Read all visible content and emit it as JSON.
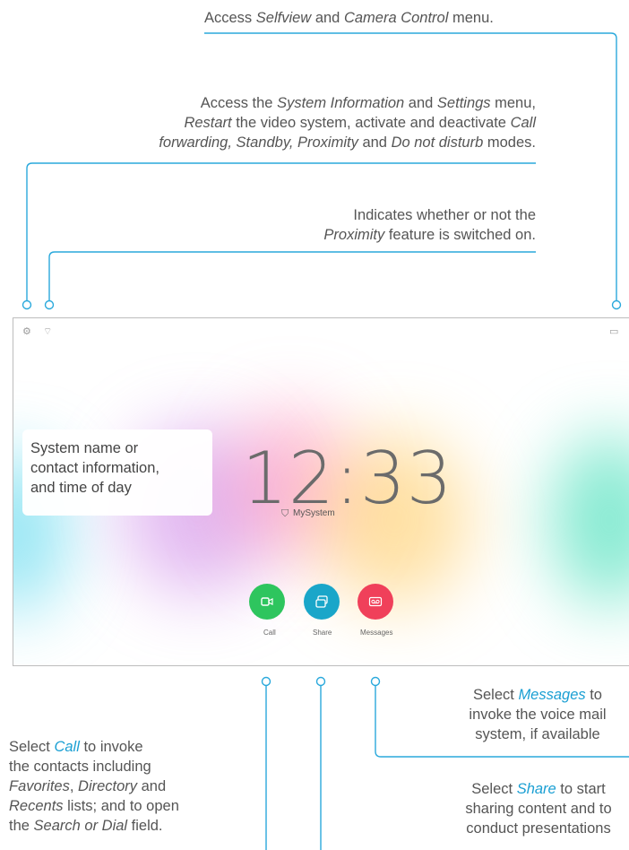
{
  "annotations": {
    "selfview": {
      "t1": "Access ",
      "t2": "Selfview",
      "t3": " and ",
      "t4": "Camera Control",
      "t5": " menu."
    },
    "settings": {
      "l1a": "Access the ",
      "l1b": "System Information",
      "l1c": " and ",
      "l1d": "Settings",
      "l1e": " menu,",
      "l2a": "Restart",
      "l2b": " the video system, activate and deactivate ",
      "l2c": "Call",
      "l3a": "forwarding, Standby, Proximity",
      "l3b": " and ",
      "l3c": "Do not disturb",
      "l3d": " modes."
    },
    "proximity": {
      "l1": "Indicates whether or not the",
      "l2a": "Proximity",
      "l2b": " feature is switched on."
    },
    "messages": {
      "l1a": "Select ",
      "l1b": "Messages",
      "l1c": " to",
      "l2": "invoke the voice mail",
      "l3": "system, if available"
    },
    "call": {
      "l1a": "Select ",
      "l1b": "Call",
      "l1c": " to invoke",
      "l2": "the contacts including",
      "l3a": "Favorites",
      "l3b": ", ",
      "l3c": "Directory",
      "l3d": " and",
      "l4a": "Recents",
      "l4b": " lists; and to open",
      "l5a": "the ",
      "l5b": "Search or Dial",
      "l5c": " field."
    },
    "share": {
      "l1a": "Select ",
      "l1b": "Share",
      "l1c": " to start",
      "l2": "sharing content and to",
      "l3": "conduct presentations"
    }
  },
  "screen": {
    "time": "12:33",
    "system_name": "MySystem",
    "callout": "System name or contact information, and time of day",
    "callout_lines": [
      "System name or",
      "contact information,",
      "and time of day"
    ],
    "buttons": [
      {
        "label": "Call",
        "color": "#2ec55e",
        "icon": "video-camera-icon"
      },
      {
        "label": "Share",
        "color": "#1aa6c9",
        "icon": "share-screen-icon"
      },
      {
        "label": "Messages",
        "color": "#f0405a",
        "icon": "voicemail-icon"
      }
    ],
    "top_icons": [
      "settings-gear-icon",
      "proximity-icon",
      "selfview-camera-icon"
    ]
  },
  "colors": {
    "accent": "#1a9fd3",
    "line": "#29a8dc"
  }
}
